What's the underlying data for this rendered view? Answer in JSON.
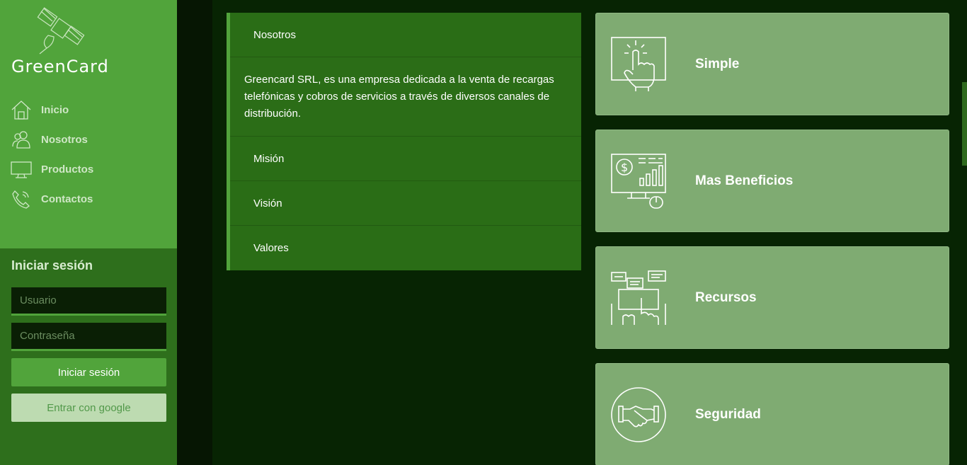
{
  "brand": {
    "name": "GreenCard",
    "logo_icon": "satellite-icon"
  },
  "nav": [
    {
      "label": "Inicio",
      "icon": "home-icon"
    },
    {
      "label": "Nosotros",
      "icon": "users-icon"
    },
    {
      "label": "Productos",
      "icon": "monitor-icon"
    },
    {
      "label": "Contactos",
      "icon": "phone-icon"
    }
  ],
  "login": {
    "title": "Iniciar sesión",
    "user_placeholder": "Usuario",
    "pass_placeholder": "Contraseña",
    "submit_label": "Iniciar sesión",
    "google_label": "Entrar con google"
  },
  "accordion": {
    "open_title": "Nosotros",
    "open_body": "Greencard SRL, es una empresa dedicada a la venta de recargas telefónicas y cobros de servicios a través de diversos canales de distribución.",
    "items": [
      "Misión",
      "Visión",
      "Valores"
    ]
  },
  "cards": [
    {
      "title": "Simple",
      "icon": "touch-screen-icon"
    },
    {
      "title": "Mas Beneficios",
      "icon": "finance-dashboard-icon"
    },
    {
      "title": "Recursos",
      "icon": "chat-collaboration-icon"
    },
    {
      "title": "Seguridad",
      "icon": "handshake-icon"
    }
  ],
  "colors": {
    "sidebar": "#51a43b",
    "login_bg": "#2e6f1c",
    "card": "#7fab72",
    "accordion": "#2a6d16",
    "page": "#072403"
  }
}
